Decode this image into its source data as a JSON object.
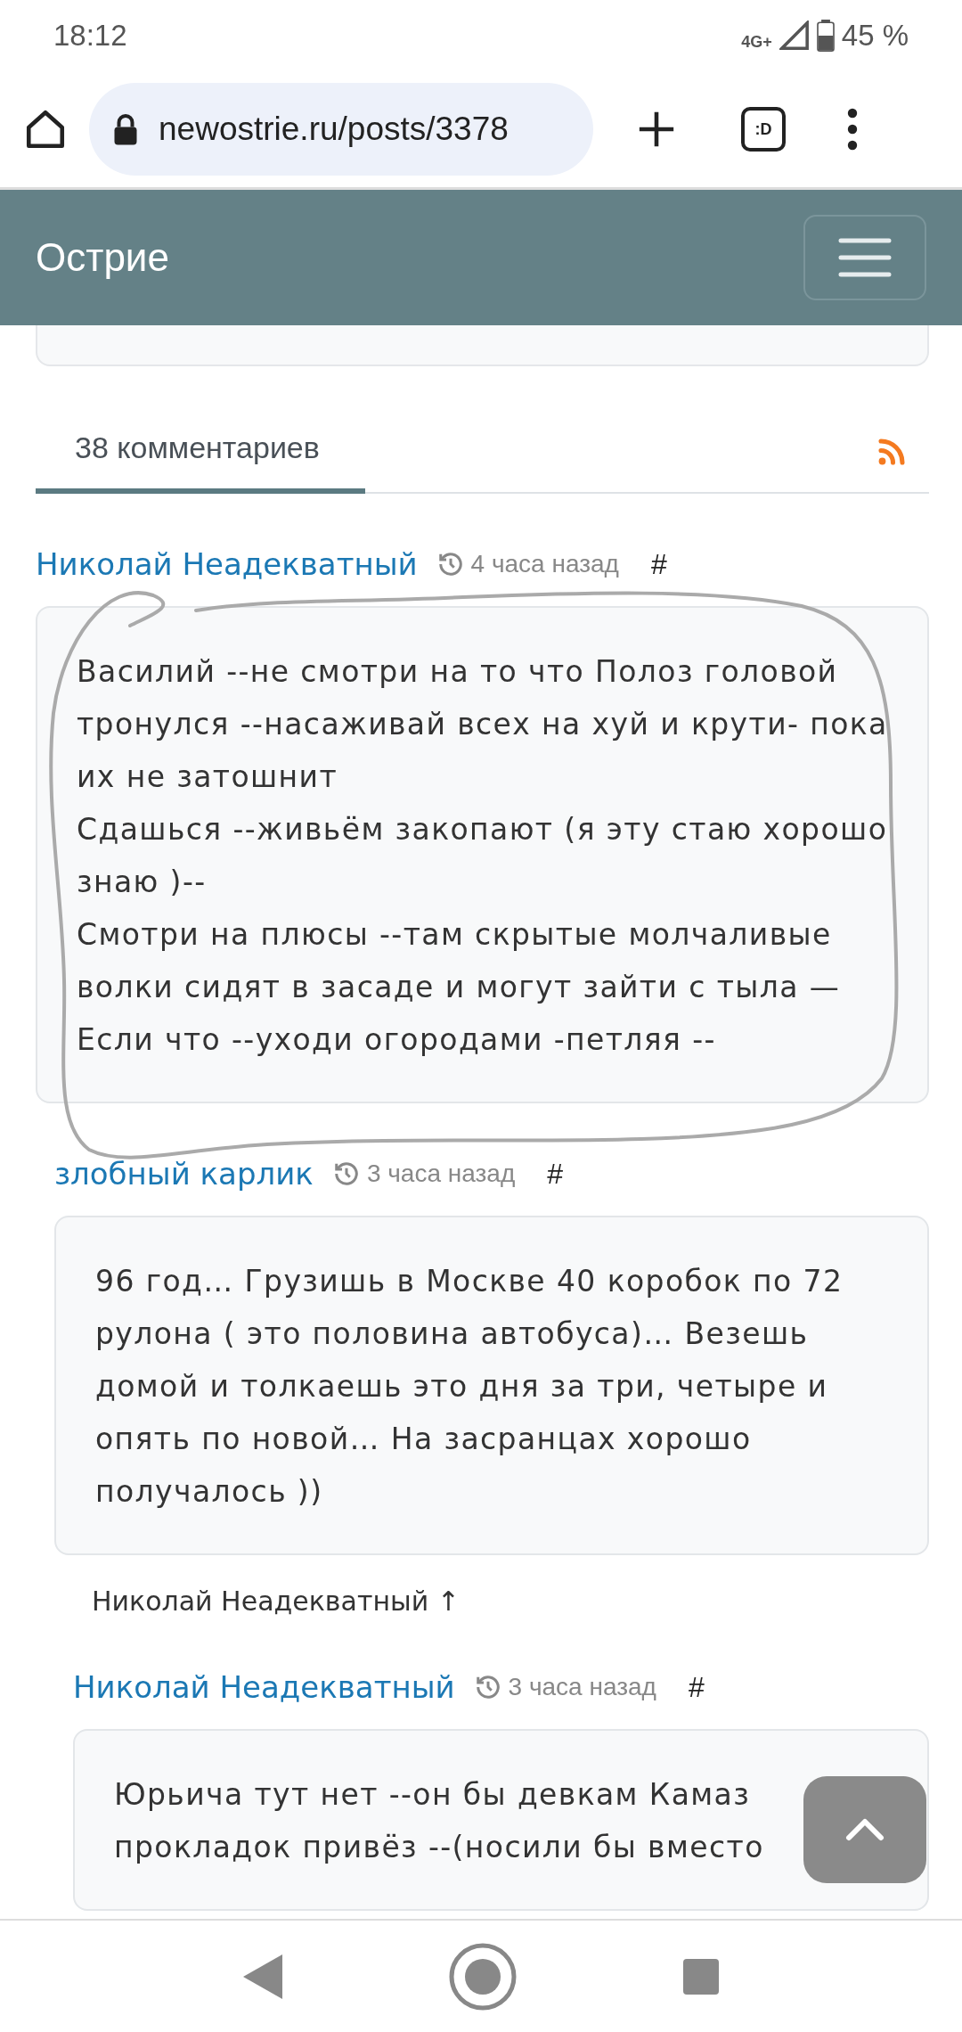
{
  "status_bar": {
    "time": "18:12",
    "network": "4G+",
    "battery": "45 %"
  },
  "browser": {
    "url": "newostrie.ru/posts/3378",
    "tab_switcher": ":D"
  },
  "navbar": {
    "brand": "Острие"
  },
  "comments_tab": {
    "label": "38 комментариев",
    "selected": true
  },
  "comments": [
    {
      "author": "Николай Неадекватный",
      "time": "4 часа назад",
      "anchor": "#",
      "paragraphs": [
        "Василий --не смотри на то что Полоз головой тронулся --насаживай всех на хуй и крути- пока их не затошнит",
        "Сдашься --живьём закопают (я эту стаю хорошо знаю )--",
        "Смотри на плюсы --там скрытые молчаливые волки сидят в засаде и могут зайти с тыла —",
        "Если что --уходи огородами -петляя --"
      ],
      "children": [
        {
          "author": "злобный карлик",
          "time": "3 часа назад",
          "anchor": "#",
          "paragraphs": [
            "96 год… Грузишь в Москве 40 коробок по 72 рулона ( это половина автобуса)… Везешь домой и толкаешь это дня за три, четыре и опять по новой… На засранцах хорошо получалось ))"
          ],
          "reply_link": "Николай Неадекватный ↑",
          "children": [
            {
              "author": "Николай Неадекватный",
              "time": "3 часа назад",
              "anchor": "#",
              "paragraphs": [
                "Юрьича тут нет --он бы девкам Камаз прокладок привёз --(носили бы вместо"
              ]
            }
          ]
        }
      ]
    }
  ]
}
